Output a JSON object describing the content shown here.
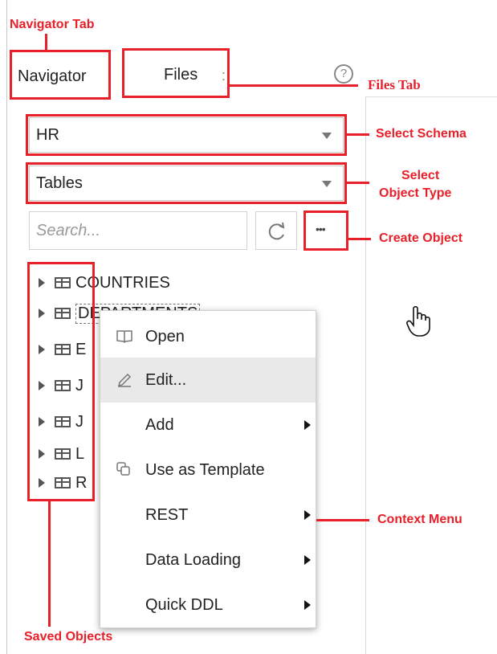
{
  "tabs": {
    "navigator": "Navigator",
    "files": "Files"
  },
  "help_icon": "help-circle-icon",
  "schema_select": {
    "value": "HR"
  },
  "object_type_select": {
    "value": "Tables"
  },
  "search": {
    "placeholder": "Search..."
  },
  "refresh_icon": "refresh-icon",
  "more_icon": "ellipsis-icon",
  "more_glyph": "•••",
  "tree": {
    "items": [
      {
        "label": "COUNTRIES"
      },
      {
        "label": "DEPARTMENTS"
      },
      {
        "label": "E"
      },
      {
        "label": "J"
      },
      {
        "label": "J"
      },
      {
        "label": "L"
      },
      {
        "label": "R"
      }
    ]
  },
  "context_menu": {
    "items": [
      {
        "label": "Open",
        "icon": "book-icon",
        "submenu": false
      },
      {
        "label": "Edit...",
        "icon": "pencil-icon",
        "submenu": false,
        "highlighted": true
      },
      {
        "label": "Add",
        "icon": "",
        "submenu": true
      },
      {
        "label": "Use as Template",
        "icon": "copy-icon",
        "submenu": false
      },
      {
        "label": "REST",
        "icon": "",
        "submenu": true
      },
      {
        "label": "Data Loading",
        "icon": "",
        "submenu": true
      },
      {
        "label": "Quick DDL",
        "icon": "",
        "submenu": true
      }
    ]
  },
  "annotations": {
    "navigator_tab": "Navigator Tab",
    "files_tab": "Files Tab",
    "select_schema": "Select Schema",
    "select_object_type_line1": "Select",
    "select_object_type_line2": "Object Type",
    "create_object": "Create Object",
    "context_menu": "Context Menu",
    "saved_objects": "Saved Objects"
  },
  "colors": {
    "annotation_red": "#e8202a",
    "menu_highlight": "#e9e9e9"
  }
}
